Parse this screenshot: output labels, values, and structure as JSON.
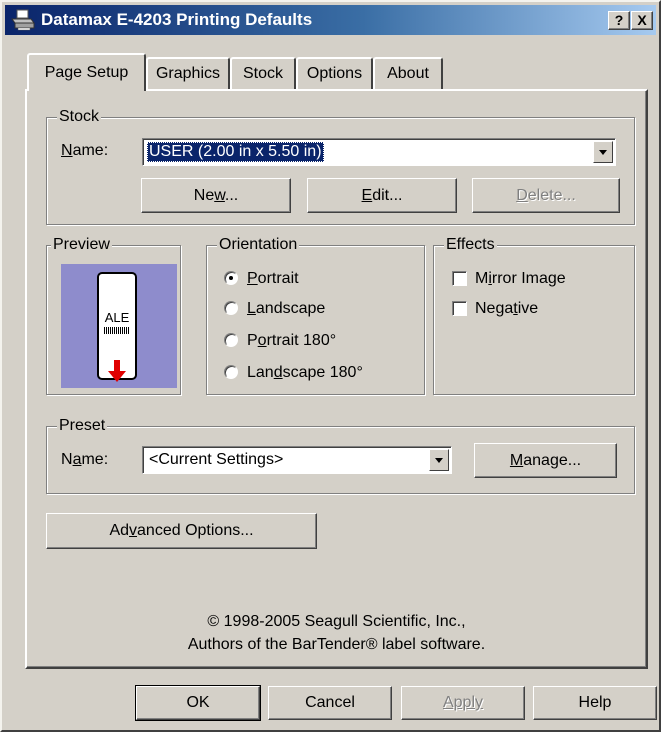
{
  "window": {
    "title": "Datamax E-4203 Printing Defaults",
    "help_btn": "?",
    "close_btn": "X"
  },
  "tabs": [
    {
      "label": "Page Setup",
      "active": true
    },
    {
      "label": "Graphics",
      "active": false
    },
    {
      "label": "Stock",
      "active": false
    },
    {
      "label": "Options",
      "active": false
    },
    {
      "label": "About",
      "active": false
    }
  ],
  "stock": {
    "group_label": "Stock",
    "name_label": "Name:",
    "name_value": "USER (2.00 in x 5.50 in)",
    "new_btn": "New...",
    "edit_btn": "Edit...",
    "delete_btn": "Delete..."
  },
  "preview": {
    "group_label": "Preview",
    "label_text": "ALE",
    "barcode_text": "||||||||||"
  },
  "orientation": {
    "group_label": "Orientation",
    "options": [
      "Portrait",
      "Landscape",
      "Portrait 180°",
      "Landscape 180°"
    ],
    "selected": "Portrait"
  },
  "effects": {
    "group_label": "Effects",
    "mirror": "Mirror Image",
    "negative": "Negative"
  },
  "preset": {
    "group_label": "Preset",
    "name_label": "Name:",
    "name_value": "<Current Settings>",
    "manage_btn": "Manage..."
  },
  "advanced_btn": "Advanced Options...",
  "copyright": {
    "line1": "© 1998-2005 Seagull Scientific, Inc.,",
    "line2": "Authors of the BarTender® label software."
  },
  "buttons": {
    "ok": "OK",
    "cancel": "Cancel",
    "apply": "Apply",
    "help": "Help"
  },
  "colors": {
    "titlebar_start": "#0a246a",
    "titlebar_end": "#a6caf0",
    "face": "#d4d0c8",
    "preview_bg": "#8e8ccc",
    "arrow_red": "#e00000"
  }
}
